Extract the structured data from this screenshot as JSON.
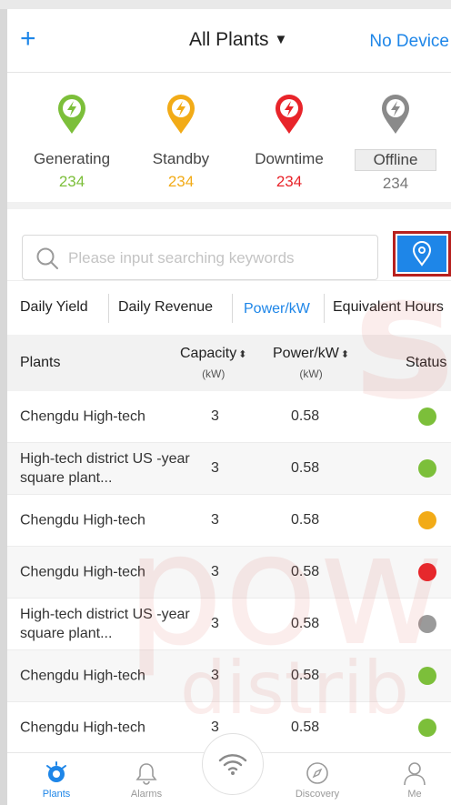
{
  "header": {
    "add_label": "+",
    "title": "All Plants",
    "title_caret": "▼",
    "right_label": "No Device"
  },
  "status": [
    {
      "label": "Generating",
      "count": "234",
      "color": "#7cbf3a"
    },
    {
      "label": "Standby",
      "count": "234",
      "color": "#f2ab17"
    },
    {
      "label": "Downtime",
      "count": "234",
      "color": "#e8242a"
    },
    {
      "label": "Offline",
      "count": "234",
      "color": "#8a8a8a"
    }
  ],
  "search": {
    "placeholder": "Please input searching keywords"
  },
  "tabs": [
    {
      "label": "Daily Yield"
    },
    {
      "label": "Daily Revenue"
    },
    {
      "label": "Power/kW",
      "active": true
    },
    {
      "label": "Equivalent Hours"
    }
  ],
  "table": {
    "headers": {
      "plants": "Plants",
      "capacity": "Capacity",
      "capacity_unit": "(kW)",
      "power": "Power/kW",
      "power_unit": "(kW)",
      "status": "Status",
      "sort_icon": "⬍"
    },
    "rows": [
      {
        "name": "Chengdu High-tech",
        "capacity": "3",
        "power": "0.58",
        "status_color": "#7cbf3a"
      },
      {
        "name": "High-tech district US -year square plant...",
        "capacity": "3",
        "power": "0.58",
        "status_color": "#7cbf3a"
      },
      {
        "name": "Chengdu High-tech",
        "capacity": "3",
        "power": "0.58",
        "status_color": "#f2ab17"
      },
      {
        "name": "Chengdu High-tech",
        "capacity": "3",
        "power": "0.58",
        "status_color": "#e8242a"
      },
      {
        "name": "High-tech district US -year square plant...",
        "capacity": "3",
        "power": "0.58",
        "status_color": "#9a9a9a"
      },
      {
        "name": "Chengdu High-tech",
        "capacity": "3",
        "power": "0.58",
        "status_color": "#7cbf3a"
      },
      {
        "name": "Chengdu High-tech",
        "capacity": "3",
        "power": "0.58",
        "status_color": "#7cbf3a"
      }
    ]
  },
  "nav": {
    "plants": "Plants",
    "alarms": "Alarms",
    "discovery": "Discovery",
    "me": "Me"
  },
  "watermark": {
    "line1": "sol",
    "line2": "pow",
    "line3": "distrib"
  },
  "colors": {
    "accent": "#1e86e8",
    "highlight_border": "#b7211f"
  }
}
